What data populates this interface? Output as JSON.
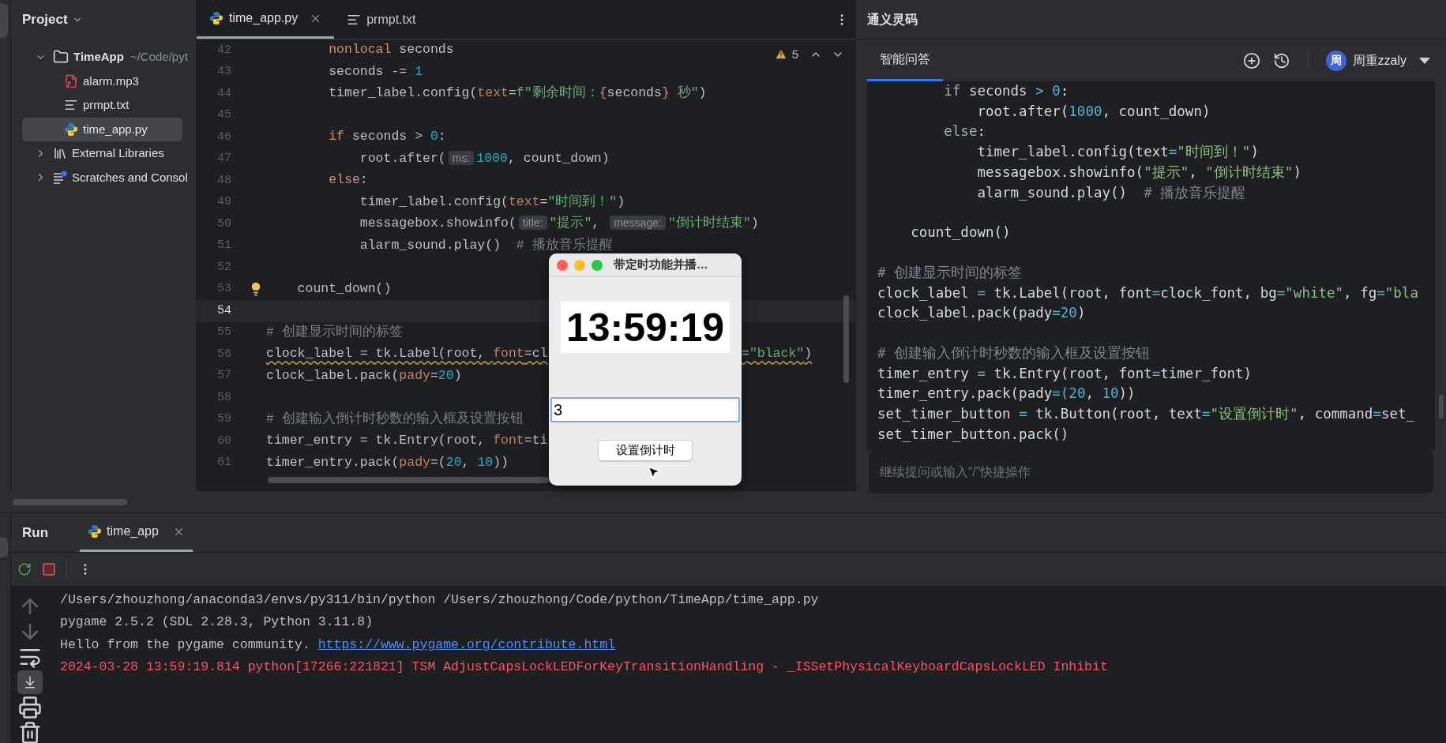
{
  "project_panel": {
    "title": "Project",
    "tree": [
      {
        "label": "TimeApp",
        "path": "~/Code/pyt",
        "kind": "folder",
        "expanded": true,
        "selected": false,
        "children": [
          {
            "label": "alarm.mp3",
            "kind": "audio",
            "selected": false
          },
          {
            "label": "prmpt.txt",
            "kind": "text",
            "selected": false
          },
          {
            "label": "time_app.py",
            "kind": "python",
            "selected": true
          }
        ]
      },
      {
        "label": "External Libraries",
        "kind": "library",
        "expanded": false,
        "selected": false
      },
      {
        "label": "Scratches and Consol",
        "kind": "scratches",
        "expanded": false,
        "selected": false
      }
    ]
  },
  "editor": {
    "tabs": [
      {
        "label": "time_app.py",
        "kind": "python",
        "selected": true,
        "closable": true
      },
      {
        "label": "prmpt.txt",
        "kind": "text",
        "selected": false,
        "closable": false
      }
    ],
    "warnings": "5",
    "lines": [
      {
        "number": "42",
        "current": false,
        "segments": [
          {
            "kind": "kw",
            "text": "        nonlocal"
          },
          {
            "kind": "plain",
            "text": " seconds"
          }
        ]
      },
      {
        "number": "43",
        "current": false,
        "segments": [
          {
            "kind": "plain",
            "text": "        seconds -= "
          },
          {
            "kind": "num",
            "text": "1"
          }
        ]
      },
      {
        "number": "44",
        "current": false,
        "segments": [
          {
            "kind": "plain",
            "text": "        timer_label.config("
          },
          {
            "kind": "param",
            "text": "text"
          },
          {
            "kind": "plain",
            "text": "="
          },
          {
            "kind": "str",
            "text": "f\"剩余时间："
          },
          {
            "kind": "kw",
            "text": "{"
          },
          {
            "kind": "plain",
            "text": "seconds"
          },
          {
            "kind": "kw",
            "text": "}"
          },
          {
            "kind": "str",
            "text": " 秒\""
          },
          {
            "kind": "plain",
            "text": ")"
          }
        ]
      },
      {
        "number": "45",
        "current": false
      },
      {
        "number": "46",
        "current": false,
        "segments": [
          {
            "kind": "kw",
            "text": "        if"
          },
          {
            "kind": "plain",
            "text": " seconds > "
          },
          {
            "kind": "num",
            "text": "0"
          },
          {
            "kind": "plain",
            "text": ":"
          }
        ]
      },
      {
        "number": "47",
        "current": false,
        "segments": [
          {
            "kind": "plain",
            "text": "            root.after("
          },
          {
            "kind": "hint",
            "text": "ms:"
          },
          {
            "kind": "num",
            "text": "1000"
          },
          {
            "kind": "plain",
            "text": ", count_down)"
          }
        ]
      },
      {
        "number": "48",
        "current": false,
        "segments": [
          {
            "kind": "kw",
            "text": "        else"
          },
          {
            "kind": "plain",
            "text": ":"
          }
        ]
      },
      {
        "number": "49",
        "current": false,
        "segments": [
          {
            "kind": "plain",
            "text": "            timer_label.config("
          },
          {
            "kind": "param",
            "text": "text"
          },
          {
            "kind": "plain",
            "text": "="
          },
          {
            "kind": "str",
            "text": "\"时间到！\""
          },
          {
            "kind": "plain",
            "text": ")"
          }
        ]
      },
      {
        "number": "50",
        "current": false,
        "segments": [
          {
            "kind": "plain",
            "text": "            messagebox.showinfo("
          },
          {
            "kind": "hint",
            "text": "title:"
          },
          {
            "kind": "str",
            "text": "\"提示\""
          },
          {
            "kind": "plain",
            "text": ", "
          },
          {
            "kind": "hint",
            "text": "message:"
          },
          {
            "kind": "str",
            "text": "\"倒计时结束\""
          },
          {
            "kind": "plain",
            "text": ")"
          }
        ]
      },
      {
        "number": "51",
        "current": false,
        "segments": [
          {
            "kind": "plain",
            "text": "            alarm_sound.play()  "
          },
          {
            "kind": "comment",
            "text": "# 播放音乐提醒"
          }
        ]
      },
      {
        "number": "52",
        "current": false
      },
      {
        "number": "53",
        "current": false,
        "bulb": true,
        "segments": [
          {
            "kind": "plain",
            "text": "    count_down()"
          }
        ]
      },
      {
        "number": "54",
        "current": true
      },
      {
        "number": "55",
        "current": false,
        "segments": [
          {
            "kind": "comment",
            "text": "# 创建显示时间的标签"
          }
        ]
      },
      {
        "number": "56",
        "current": false,
        "warning": true,
        "segments": [
          {
            "kind": "plain",
            "text": "clock_label = tk.Label(root, "
          },
          {
            "kind": "param",
            "text": "font"
          },
          {
            "kind": "plain",
            "text": "=cl"
          }
        ],
        "tail": [
          {
            "kind": "plain",
            "text": "="
          },
          {
            "kind": "str",
            "text": "\"black\""
          },
          {
            "kind": "plain",
            "text": ")"
          }
        ]
      },
      {
        "number": "57",
        "current": false,
        "segments": [
          {
            "kind": "plain",
            "text": "clock_label.pack("
          },
          {
            "kind": "param",
            "text": "pady"
          },
          {
            "kind": "plain",
            "text": "="
          },
          {
            "kind": "num",
            "text": "20"
          },
          {
            "kind": "plain",
            "text": ")"
          }
        ]
      },
      {
        "number": "58",
        "current": false
      },
      {
        "number": "59",
        "current": false,
        "segments": [
          {
            "kind": "comment",
            "text": "# 创建输入倒计时秒数的输入框及设置按钮"
          }
        ]
      },
      {
        "number": "60",
        "current": false,
        "segments": [
          {
            "kind": "plain",
            "text": "timer_entry = tk.Entry(root, "
          },
          {
            "kind": "param",
            "text": "font"
          },
          {
            "kind": "plain",
            "text": "=ti"
          }
        ]
      },
      {
        "number": "61",
        "current": false,
        "segments": [
          {
            "kind": "plain",
            "text": "timer_entry.pack("
          },
          {
            "kind": "param",
            "text": "pady"
          },
          {
            "kind": "plain",
            "text": "=("
          },
          {
            "kind": "num",
            "text": "20"
          },
          {
            "kind": "plain",
            "text": ", "
          },
          {
            "kind": "num",
            "text": "10"
          },
          {
            "kind": "plain",
            "text": "))"
          }
        ]
      }
    ]
  },
  "dialog": {
    "title": "带定时功能并播…",
    "clock": "13:59:19",
    "entry_value": "3",
    "button": "设置倒计时"
  },
  "assistant": {
    "title": "通义灵码",
    "tabs": [
      {
        "label": "智能问答",
        "selected": true
      }
    ],
    "avatar": "周",
    "user": "周重zzaly",
    "code_lines": [
      {
        "segments": [
          {
            "kind": "kw",
            "text": "        if"
          },
          {
            "kind": "plain",
            "text": " seconds "
          },
          {
            "kind": "op",
            "text": "> "
          },
          {
            "kind": "num",
            "text": "0"
          },
          {
            "kind": "plain",
            "text": ":"
          }
        ]
      },
      {
        "segments": [
          {
            "kind": "plain",
            "text": "            root.after("
          },
          {
            "kind": "num",
            "text": "1000"
          },
          {
            "kind": "plain",
            "text": ", count_down)"
          }
        ]
      },
      {
        "segments": [
          {
            "kind": "kw",
            "text": "        else"
          },
          {
            "kind": "plain",
            "text": ":"
          }
        ]
      },
      {
        "segments": [
          {
            "kind": "plain",
            "text": "            timer_label.config(text"
          },
          {
            "kind": "op",
            "text": "="
          },
          {
            "kind": "str",
            "text": "\"时间到！\""
          },
          {
            "kind": "plain",
            "text": ")"
          }
        ]
      },
      {
        "segments": [
          {
            "kind": "plain",
            "text": "            messagebox.showinfo("
          },
          {
            "kind": "str",
            "text": "\"提示\""
          },
          {
            "kind": "plain",
            "text": ", "
          },
          {
            "kind": "str",
            "text": "\"倒计时结束\""
          },
          {
            "kind": "plain",
            "text": ")"
          }
        ]
      },
      {
        "segments": [
          {
            "kind": "plain",
            "text": "            alarm_sound.play()  "
          },
          {
            "kind": "comment",
            "text": "# 播放音乐提醒"
          }
        ]
      },
      {
        "blank_before": true,
        "segments": [
          {
            "kind": "plain",
            "text": "    count_down()"
          }
        ]
      },
      {
        "blank_before": true,
        "segments": [
          {
            "kind": "comment",
            "text": "# 创建显示时间的标签"
          }
        ]
      },
      {
        "segments": [
          {
            "kind": "plain",
            "text": "clock_label "
          },
          {
            "kind": "op",
            "text": "="
          },
          {
            "kind": "plain",
            "text": " tk.Label(root, font"
          },
          {
            "kind": "op",
            "text": "="
          },
          {
            "kind": "plain",
            "text": "clock_font, bg"
          },
          {
            "kind": "op",
            "text": "="
          },
          {
            "kind": "str",
            "text": "\"white\""
          },
          {
            "kind": "plain",
            "text": ", fg"
          },
          {
            "kind": "op",
            "text": "="
          },
          {
            "kind": "str",
            "text": "\"bla"
          }
        ]
      },
      {
        "segments": [
          {
            "kind": "plain",
            "text": "clock_label.pack(pady"
          },
          {
            "kind": "op",
            "text": "="
          },
          {
            "kind": "num",
            "text": "20"
          },
          {
            "kind": "plain",
            "text": ")"
          }
        ]
      },
      {
        "blank_before": true,
        "segments": [
          {
            "kind": "comment",
            "text": "# 创建输入倒计时秒数的输入框及设置按钮"
          }
        ]
      },
      {
        "segments": [
          {
            "kind": "plain",
            "text": "timer_entry "
          },
          {
            "kind": "op",
            "text": "="
          },
          {
            "kind": "plain",
            "text": " tk.Entry(root, font"
          },
          {
            "kind": "op",
            "text": "="
          },
          {
            "kind": "plain",
            "text": "timer_font)"
          }
        ]
      },
      {
        "segments": [
          {
            "kind": "plain",
            "text": "timer_entry.pack(pady"
          },
          {
            "kind": "op",
            "text": "=("
          },
          {
            "kind": "num",
            "text": "20"
          },
          {
            "kind": "plain",
            "text": ", "
          },
          {
            "kind": "num",
            "text": "10"
          },
          {
            "kind": "plain",
            "text": "))"
          }
        ]
      },
      {
        "segments": [
          {
            "kind": "plain",
            "text": "set_timer_button "
          },
          {
            "kind": "op",
            "text": "="
          },
          {
            "kind": "plain",
            "text": " tk.Button(root, text"
          },
          {
            "kind": "op",
            "text": "="
          },
          {
            "kind": "str",
            "text": "\"设置倒计时\""
          },
          {
            "kind": "plain",
            "text": ", command"
          },
          {
            "kind": "op",
            "text": "="
          },
          {
            "kind": "plain",
            "text": "set_"
          }
        ]
      },
      {
        "segments": [
          {
            "kind": "plain",
            "text": "set_timer_button.pack()"
          }
        ]
      }
    ],
    "input": {
      "placeholder": "继续提问或输入“/”快捷操作"
    }
  },
  "run_panel": {
    "title": "Run",
    "tabs": [
      {
        "label": "time_app",
        "selected": true
      }
    ],
    "tools": [
      {
        "kind": "up",
        "selected": false
      },
      {
        "kind": "down",
        "selected": false
      },
      {
        "kind": "wrap",
        "selected": false
      },
      {
        "kind": "scroll-end",
        "selected": true
      },
      {
        "kind": "print",
        "selected": false
      },
      {
        "kind": "trash",
        "selected": false
      }
    ],
    "console": [
      {
        "kind": "plain",
        "text": "/Users/zhouzhong/anaconda3/envs/py311/bin/python /Users/zhouzhong/Code/python/TimeApp/time_app.py"
      },
      {
        "kind": "plain",
        "text": "pygame 2.5.2 (SDL 2.28.3, Python 3.11.8)"
      },
      {
        "kind": "link",
        "text": "Hello from the pygame community. ",
        "link": "https://www.pygame.org/contribute.html"
      },
      {
        "kind": "error",
        "text": "2024-03-28 13:59:19.814 python[17266:221821] TSM AdjustCapsLockLEDForKeyTransitionHandling - _ISSetPhysicalKeyboardCapsLockLED Inhibit"
      }
    ]
  }
}
